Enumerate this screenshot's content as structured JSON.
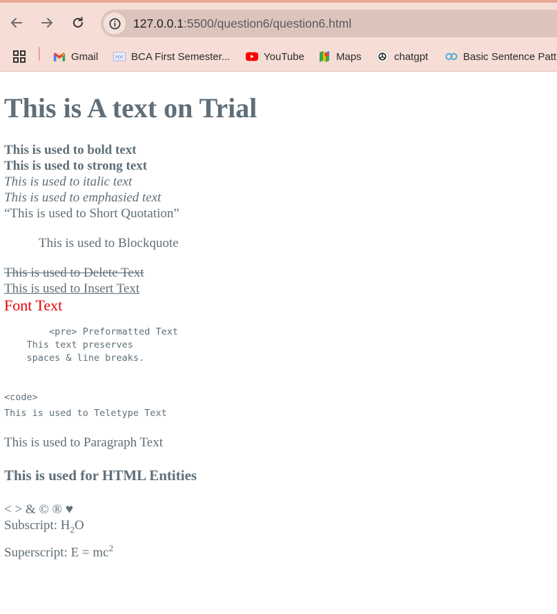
{
  "browser": {
    "url_host": "127.0.0.1",
    "url_rest": ":5500/question6/question6.html",
    "bookmarks": [
      {
        "label": "Gmail",
        "icon": "gmail-icon"
      },
      {
        "label": "BCA First Semester...",
        "icon": "bca-site-icon"
      },
      {
        "label": "YouTube",
        "icon": "youtube-icon"
      },
      {
        "label": "Maps",
        "icon": "maps-icon"
      },
      {
        "label": "chatgpt",
        "icon": "chatgpt-icon"
      },
      {
        "label": "Basic Sentence Patt...",
        "icon": "dual-circle-icon"
      }
    ]
  },
  "page": {
    "heading": "This is A text on Trial",
    "bold": "This is used to bold text",
    "strong": "This is used to strong text",
    "italic": "This is used to italic text",
    "emphasis": "This is used to emphasied text",
    "short_quote": "“This is used to Short Quotation”",
    "blockquote": "This is used to Blockquote",
    "delete": "This is used to Delete Text",
    "insert": "This is used to Insert Text",
    "font_text": "Font Text",
    "pre": "        <pre> Preformatted Text\n    This text preserves\n    spaces & line breaks.",
    "code_tag": "<code>",
    "teletype": "This is used to Teletype Text",
    "paragraph": "This is used to Paragraph Text",
    "entities_heading": "This is used for HTML Entities",
    "entities": "< > & © ® ♥",
    "subscript_label": "Subscript: H",
    "subscript_sub": "2",
    "subscript_tail": "O",
    "superscript_label": "Superscript: E = mc",
    "superscript_sup": "2"
  },
  "colors": {
    "chrome_bg": "#f6ddd6",
    "text": "#5f6e78",
    "font_red": "#e60000"
  }
}
